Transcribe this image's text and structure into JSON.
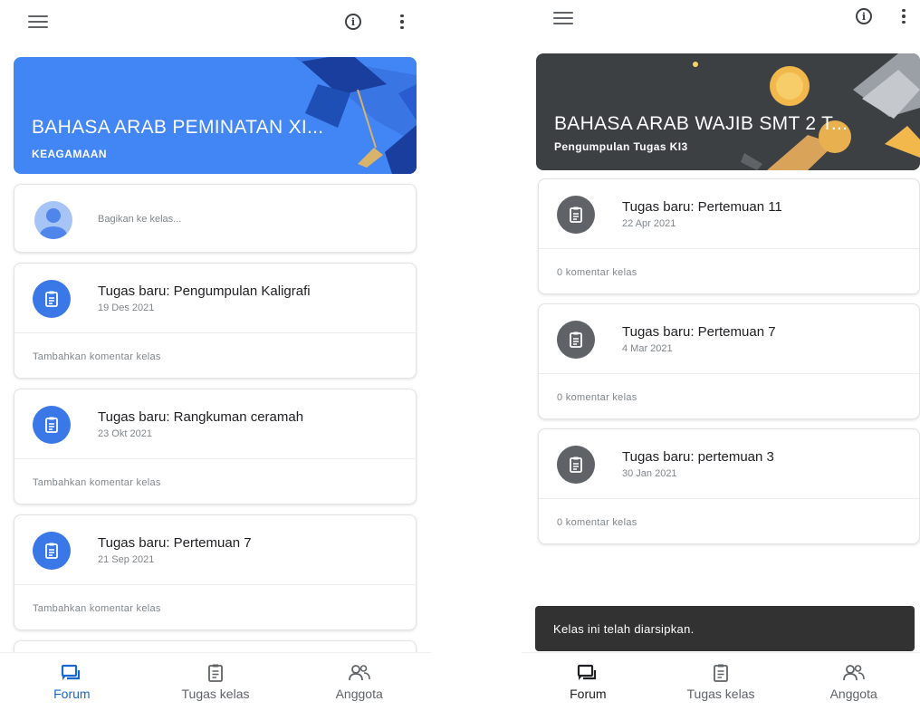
{
  "colors": {
    "left_accent": "#4285f4",
    "left_icon": "#3b78e7",
    "right_banner": "#3c4043",
    "right_icon": "#5f6368",
    "snackbar": "#323232"
  },
  "left": {
    "header": {
      "menu_icon": "hamburger-icon",
      "info_icon": "info-icon",
      "more_icon": "more-vert-icon"
    },
    "banner": {
      "title": "BAHASA ARAB PEMINATAN XI...",
      "subtitle": "KEAGAMAAN"
    },
    "share": {
      "placeholder": "Bagikan ke kelas..."
    },
    "posts": [
      {
        "title": "Tugas baru: Pengumpulan Kaligrafi",
        "date": "19 Des 2021",
        "comment": "Tambahkan komentar kelas"
      },
      {
        "title": "Tugas baru: Rangkuman ceramah",
        "date": "23 Okt 2021",
        "comment": "Tambahkan komentar kelas"
      },
      {
        "title": "Tugas baru: Pertemuan 7",
        "date": "21 Sep 2021",
        "comment": "Tambahkan komentar kelas"
      }
    ],
    "nav": [
      {
        "label": "Forum",
        "icon": "forum-icon",
        "active": true
      },
      {
        "label": "Tugas kelas",
        "icon": "classwork-icon",
        "active": false
      },
      {
        "label": "Anggota",
        "icon": "people-icon",
        "active": false
      }
    ]
  },
  "right": {
    "header": {
      "menu_icon": "hamburger-icon",
      "info_icon": "info-icon",
      "more_icon": "more-vert-icon"
    },
    "banner": {
      "title": "BAHASA ARAB WAJIB SMT 2 T...",
      "subtitle": "Pengumpulan Tugas KI3"
    },
    "posts": [
      {
        "title": "Tugas baru: Pertemuan 11",
        "date": "22 Apr 2021",
        "comment": "0 komentar kelas"
      },
      {
        "title": "Tugas baru: Pertemuan 7",
        "date": "4 Mar 2021",
        "comment": "0 komentar kelas"
      },
      {
        "title": "Tugas baru: pertemuan 3",
        "date": "30 Jan 2021",
        "comment": "0 komentar kelas"
      }
    ],
    "snackbar": "Kelas ini telah diarsipkan.",
    "nav": [
      {
        "label": "Forum",
        "icon": "forum-icon",
        "active": true
      },
      {
        "label": "Tugas kelas",
        "icon": "classwork-icon",
        "active": false
      },
      {
        "label": "Anggota",
        "icon": "people-icon",
        "active": false
      }
    ]
  }
}
